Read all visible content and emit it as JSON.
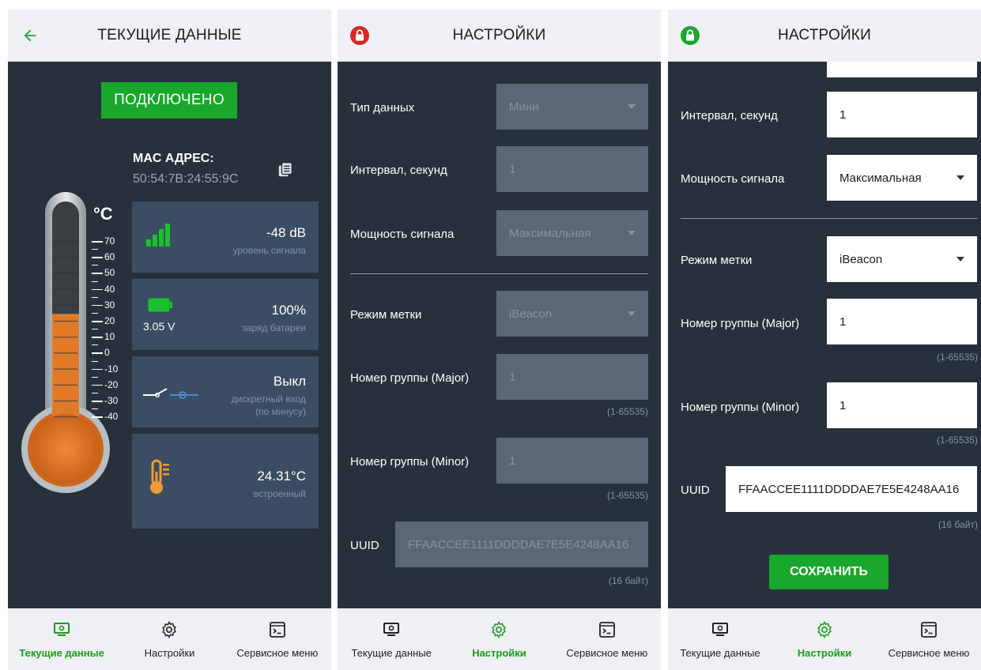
{
  "screen1": {
    "title": "ТЕКУЩИЕ ДАННЫЕ",
    "status_button": "ПОДКЛЮЧЕНО",
    "mac_label": "MAC АДРЕС:",
    "mac_value": "50:54:7B:24:55:9C",
    "thermometer": {
      "unit": "°C",
      "ticks": [
        "70",
        "60",
        "50",
        "40",
        "30",
        "20",
        "10",
        "0",
        "-10",
        "-20",
        "-30",
        "-40"
      ],
      "level_celsius": 24.31
    },
    "cards": {
      "signal": {
        "value": "-48 dB",
        "label": "уровень сигнала",
        "icon": "signal-bars-icon"
      },
      "battery": {
        "value": "100%",
        "label": "заряд батареи",
        "voltage": "3.05 V",
        "icon": "battery-icon"
      },
      "input": {
        "value": "Выкл",
        "label_line1": "дискретный вход",
        "label_line2": "(по минусу)",
        "icon": "switch-open-icon"
      },
      "temp": {
        "value": "24.31°C",
        "label": "встроенный",
        "icon": "thermometer-icon"
      }
    }
  },
  "screen2": {
    "title": "НАСТРОЙКИ",
    "lock_state": "locked",
    "data_type_label": "Тип данных",
    "data_type_value": "Мини",
    "interval_label": "Интервал, секунд",
    "interval_value": "1",
    "power_label": "Мощность сигнала",
    "power_value": "Максимальная",
    "mode_label": "Режим метки",
    "mode_value": "iBeacon",
    "major_label": "Номер группы (Major)",
    "major_value": "1",
    "major_hint": "(1-65535)",
    "minor_label": "Номер группы (Minor)",
    "minor_value": "1",
    "minor_hint": "(1-65535)",
    "uuid_label": "UUID",
    "uuid_value": "FFAACCEE1111DDDDAE7E5E4248AA16",
    "uuid_hint": "(16 байт)"
  },
  "screen3": {
    "title": "НАСТРОЙКИ",
    "lock_state": "unlocked",
    "interval_label": "Интервал, секунд",
    "interval_value": "1",
    "power_label": "Мощность сигнала",
    "power_value": "Максимальная",
    "mode_label": "Режим метки",
    "mode_value": "iBeacon",
    "major_label": "Номер группы (Major)",
    "major_value": "1",
    "major_hint": "(1-65535)",
    "minor_label": "Номер группы (Minor)",
    "minor_value": "1",
    "minor_hint": "(1-65535)",
    "uuid_label": "UUID",
    "uuid_value": "FFAACCEE1111DDDDAE7E5E4248AA16",
    "uuid_hint": "(16 байт)",
    "save_button": "СОХРАНИТЬ"
  },
  "nav": {
    "current": "Текущие данные",
    "settings": "Настройки",
    "service": "Сервисное меню"
  },
  "colors": {
    "accent_green": "#19a72c",
    "background": "#27313b",
    "card": "#3a4d62",
    "appbar": "#eef0f3",
    "lock_red": "#d62a2a",
    "thermo_fill": "#e07a2a"
  }
}
